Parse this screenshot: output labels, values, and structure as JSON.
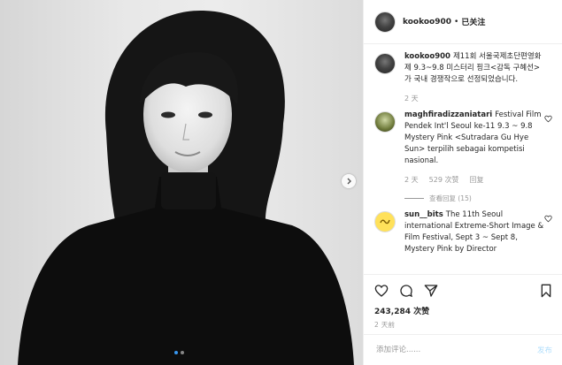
{
  "post": {
    "username": "kookoo900",
    "separator": "•",
    "follow_status": "已关注",
    "caption_user": "kookoo900",
    "caption_text": "제11회 서울국제초단편영화제 9.3~9.8 미스터리 핑크<감독 구혜선>가 국내 경쟁작으로 선정되었습니다.",
    "caption_time": "2 天",
    "likes": "243,284 次赞",
    "posted_time": "2 天前",
    "carousel": {
      "slides": 2,
      "active": 1
    }
  },
  "comments": [
    {
      "user": "maghfiradizzaniatari",
      "text": "Festival Film Pendek Int'l Seoul ke-11 9.3 ~ 9.8 Mystery Pink <Sutradara Gu Hye Sun> terpilih sebagai kompetisi nasional.",
      "time": "2 天",
      "likes": "529 次赞",
      "reply": "回复",
      "view_replies": "查看回复 (15)"
    },
    {
      "user": "sun__bits",
      "text": "The 11th Seoul international Extreme-Short Image & Film Festival, Sept 3 ~ Sept 8, Mystery Pink by Director"
    }
  ],
  "comment_box": {
    "placeholder": "添加评论......",
    "post_label": "发布"
  },
  "colors": {
    "link_blue": "#3897f0",
    "post_disabled": "#b2dffc",
    "muted": "#999999"
  },
  "icons": [
    "next-arrow-icon",
    "heart-icon",
    "comment-icon",
    "share-icon",
    "bookmark-icon"
  ]
}
